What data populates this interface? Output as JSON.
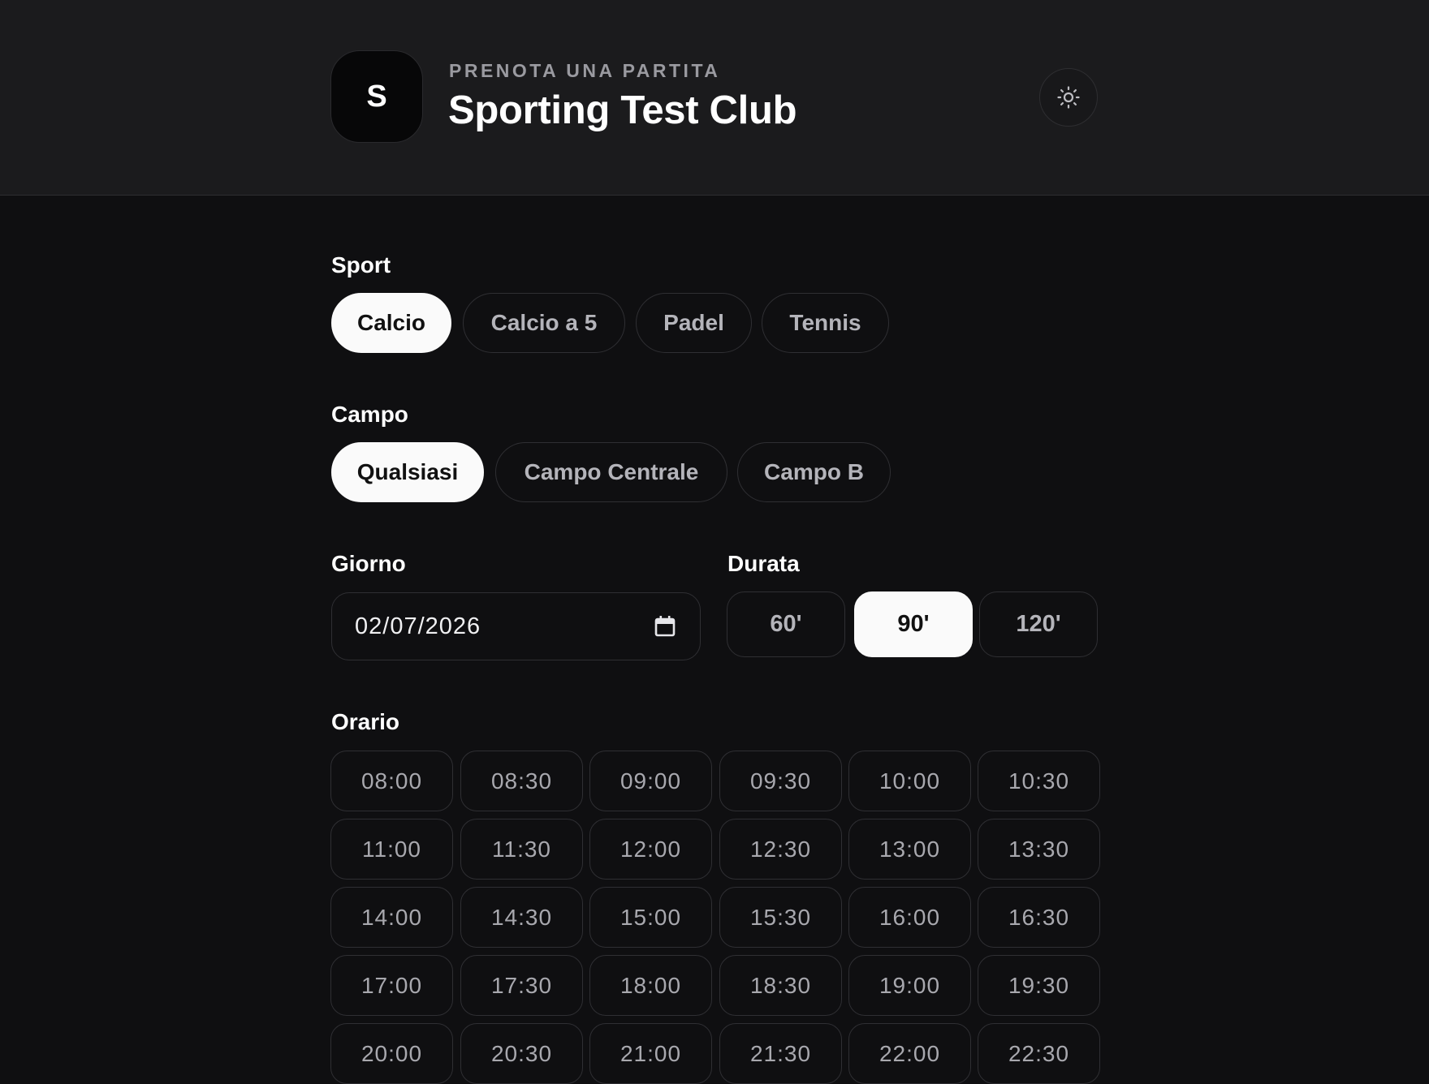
{
  "header": {
    "logo_letter": "S",
    "kicker": "PRENOTA UNA PARTITA",
    "title": "Sporting Test Club",
    "theme_toggle_icon": "sun-icon"
  },
  "sport": {
    "label": "Sport",
    "options": [
      "Calcio",
      "Calcio a 5",
      "Padel",
      "Tennis"
    ],
    "selected": "Calcio"
  },
  "campo": {
    "label": "Campo",
    "options": [
      "Qualsiasi",
      "Campo Centrale",
      "Campo B"
    ],
    "selected": "Qualsiasi"
  },
  "giorno": {
    "label": "Giorno",
    "value": "02/07/2026",
    "icon": "calendar-icon"
  },
  "durata": {
    "label": "Durata",
    "options": [
      "60'",
      "90'",
      "120'"
    ],
    "selected": "90'"
  },
  "orario": {
    "label": "Orario",
    "slots": [
      "08:00",
      "08:30",
      "09:00",
      "09:30",
      "10:00",
      "10:30",
      "11:00",
      "11:30",
      "12:00",
      "12:30",
      "13:00",
      "13:30",
      "14:00",
      "14:30",
      "15:00",
      "15:30",
      "16:00",
      "16:30",
      "17:00",
      "17:30",
      "18:00",
      "18:30",
      "19:00",
      "19:30",
      "20:00",
      "20:30",
      "21:00",
      "21:30",
      "22:00",
      "22:30"
    ]
  },
  "colors": {
    "background": "#0f0f11",
    "header": "#1b1b1d",
    "active_chip": "#fafafa",
    "border": "#2f2f33"
  }
}
